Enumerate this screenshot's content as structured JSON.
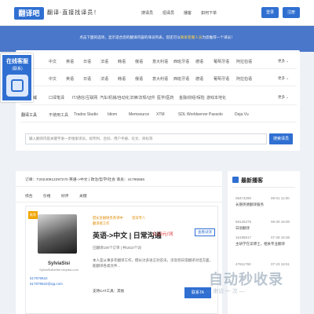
{
  "header": {
    "logo": "翻译吧",
    "slogan": "翻译·直接找译员！",
    "nav": [
      "搜译员",
      "招译员",
      "播客",
      "如何下单"
    ],
    "login": "登录",
    "register": "注册"
  },
  "banner": {
    "text_before": "点击下面的选项，显示适合您的翻译内容的译员列表。您还可以",
    "text_highlight": "联系客服人员",
    "text_after": "为您推荐一个译员！"
  },
  "kefu": {
    "title": "在线客服",
    "sub": "(联系)"
  },
  "filters": {
    "rows": [
      {
        "label": "",
        "items": [
          "中文",
          "英语",
          "日语",
          "法语",
          "韩语",
          "俄语",
          "意大利语",
          "西班牙语",
          "德语",
          "葡萄牙语",
          "阿拉伯语"
        ],
        "more": "更多"
      },
      {
        "label": "",
        "items": [
          "中文",
          "英语",
          "日语",
          "法语",
          "韩语",
          "俄语",
          "意大利语",
          "西班牙语",
          "德语",
          "葡萄牙语",
          "阿拉伯语"
        ],
        "more": "更多"
      },
      {
        "label": "所属领域",
        "items": [
          "口译笔译",
          "IT/通信/互联网",
          "汽车/机械/自动化",
          "法律/法规/证件",
          "医学/医药",
          "金融/财经/保险",
          "游戏本地化"
        ],
        "more": "更多"
      },
      {
        "label": "翻译工具",
        "items": [
          "不使用工具",
          "Trados Studio",
          "Idiom",
          "Memsource",
          "XTM",
          "SDL Worldserver",
          "Passolo",
          "Deja Vu"
        ],
        "more": ""
      }
    ],
    "search_placeholder": "输入翻译内容关键字进一步搜索译员，如专利、合同、用户手册、论文、商标等",
    "search_button": "搜索译员"
  },
  "list": {
    "order_info": "订单：T20240912297270   英语->中文 | 政治/哲学/社会   译员：41795566",
    "sort": [
      "综合",
      "价格",
      "好评",
      "关键"
    ],
    "card": {
      "badge": "推荐",
      "name": "SylviaSisi",
      "email": "SylviaSisibetter.fanyiba.com",
      "qq1": "517879622",
      "qq2": "517879622@qq.com",
      "tags": [
        "擅长金融财务英译中",
        "资深专八",
        "翻译者工作"
      ],
      "title": "英语->中文 | 日常沟通",
      "price": "0.10元/词",
      "meta": "已翻译100个订单 | 共1810个词",
      "desc": "本人是从事多年翻译工作，擅长讨多语言对答讯，涉及到日常翻译对话方面，能翻译各类文件...",
      "tool": "支持CAT工具：其他",
      "consult": "查看试译",
      "contact": "联系TA"
    }
  },
  "sidebar": {
    "title": "最新播客",
    "items": [
      {
        "num": "08473290",
        "date": "09-01 11:00",
        "title": "长期英德翻译服务"
      },
      {
        "num": "58125275",
        "date": "08-30 16:00",
        "title": "日语翻译"
      },
      {
        "num": "16195617",
        "date": "07-28 16:36",
        "title": "主研学在读博士，相关专业翻译"
      },
      {
        "num": "47611750",
        "date": "07-23 16:51",
        "title": ""
      }
    ]
  },
  "watermark": {
    "main": "自动秒收录",
    "sub": "— 来访 一 次 —"
  }
}
